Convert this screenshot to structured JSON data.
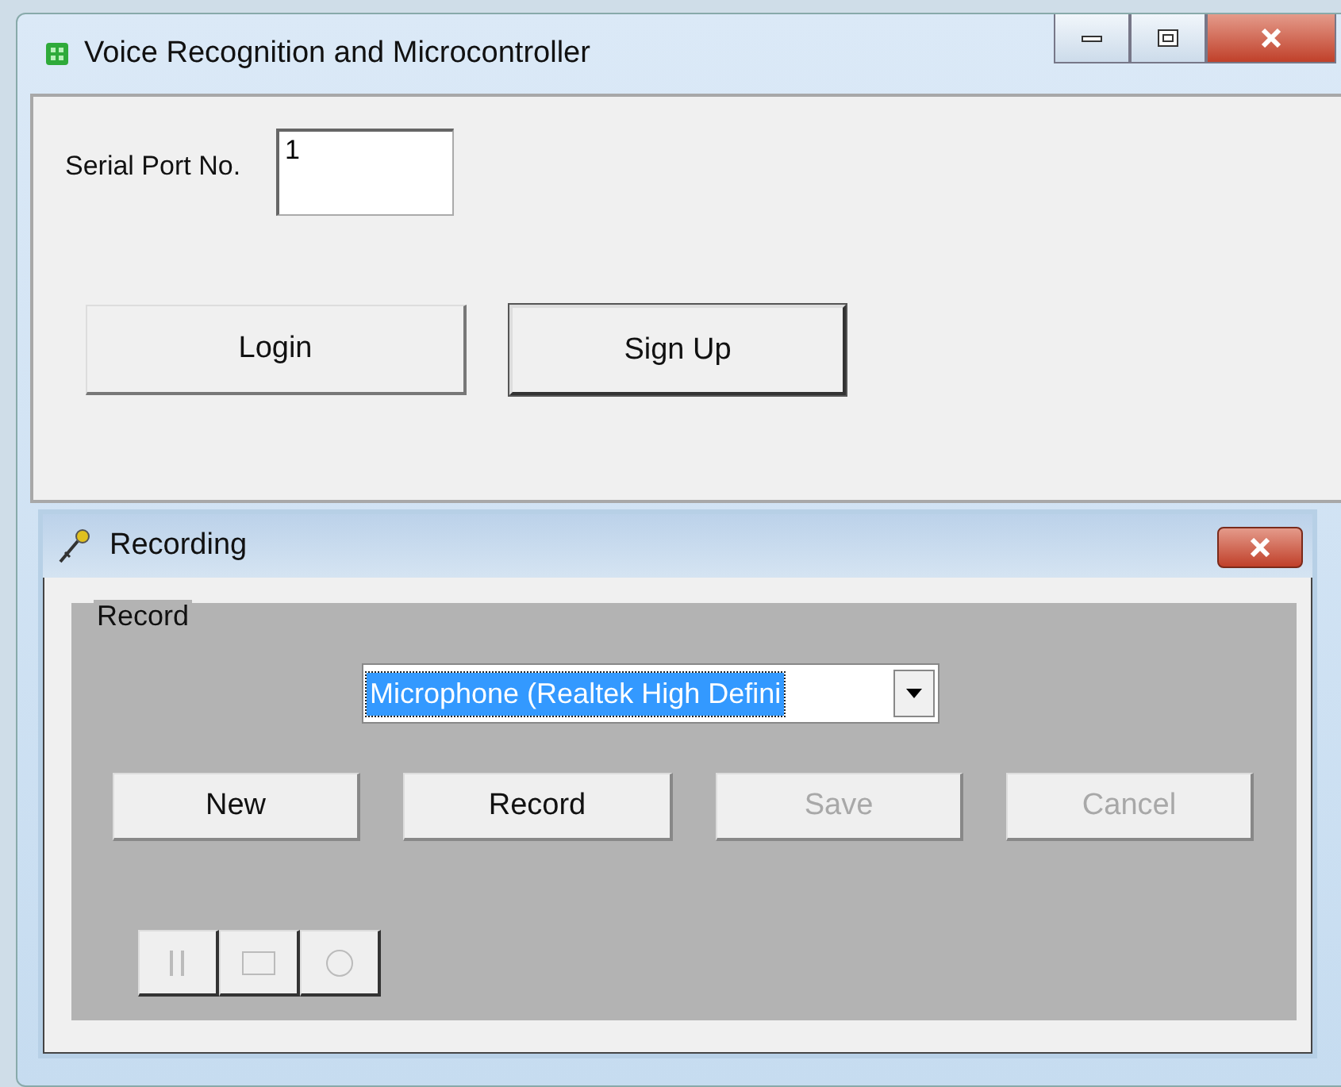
{
  "window": {
    "title": "Voice Recognition and Microcontroller"
  },
  "serial_port": {
    "label": "Serial Port No.",
    "value": "1"
  },
  "buttons": [
    {
      "label": "Login",
      "default": false
    },
    {
      "label": "Sign Up",
      "default": true
    }
  ],
  "recording": {
    "title": "Recording",
    "group": "Record",
    "device": {
      "value": "Microphone (Realtek High Defini"
    },
    "buttons": [
      {
        "label": "New",
        "disabled": false
      },
      {
        "label": "Record",
        "disabled": false
      },
      {
        "label": "Save",
        "disabled": true
      },
      {
        "label": "Cancel",
        "disabled": true
      }
    ],
    "transport": [
      {
        "kind": "pause"
      },
      {
        "kind": "stop"
      },
      {
        "kind": "record"
      }
    ]
  }
}
